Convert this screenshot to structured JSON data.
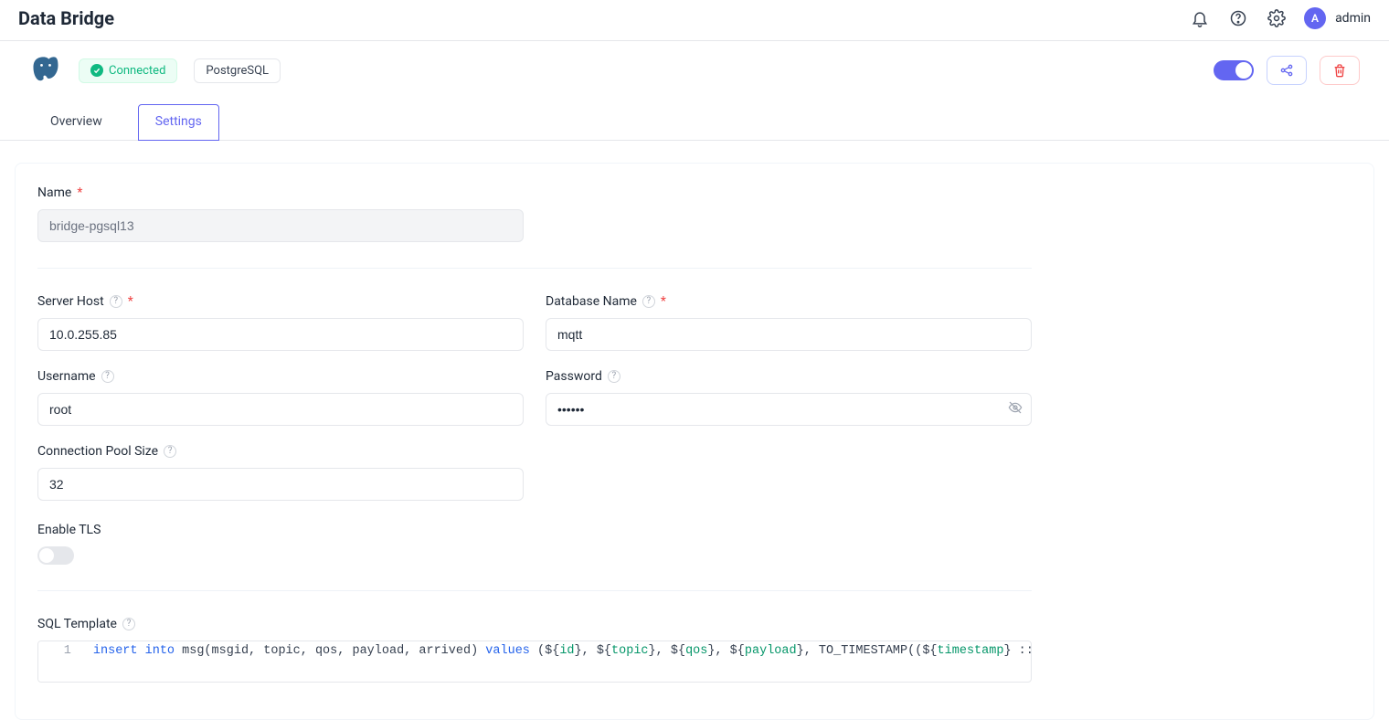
{
  "header": {
    "title": "Data Bridge",
    "user": {
      "avatar_letter": "A",
      "name": "admin"
    }
  },
  "subheader": {
    "status_label": "Connected",
    "type_chip": "PostgreSQL"
  },
  "tabs": {
    "overview": "Overview",
    "settings": "Settings"
  },
  "form": {
    "name_label": "Name",
    "name_value": "bridge-pgsql13",
    "server_host_label": "Server Host",
    "server_host_value": "10.0.255.85",
    "database_label": "Database Name",
    "database_value": "mqtt",
    "username_label": "Username",
    "username_value": "root",
    "password_label": "Password",
    "password_value": "••••••",
    "pool_label": "Connection Pool Size",
    "pool_value": "32",
    "tls_label": "Enable TLS",
    "sql_label": "SQL Template",
    "sql_tokens": {
      "t1": "insert",
      "t2": "into",
      "t3": " msg(msgid, topic, qos, payload, arrived) ",
      "t4": "values",
      "t5": " (${",
      "c1": "id",
      "t6": "}, ${",
      "c2": "topic",
      "t7": "}, ${",
      "c3": "qos",
      "t8": "}, ${",
      "c4": "payload",
      "t9": "}, TO_TIMESTAMP((${",
      "c5": "timestamp",
      "t10": "} :: bigint"
    },
    "line_number": "1"
  }
}
